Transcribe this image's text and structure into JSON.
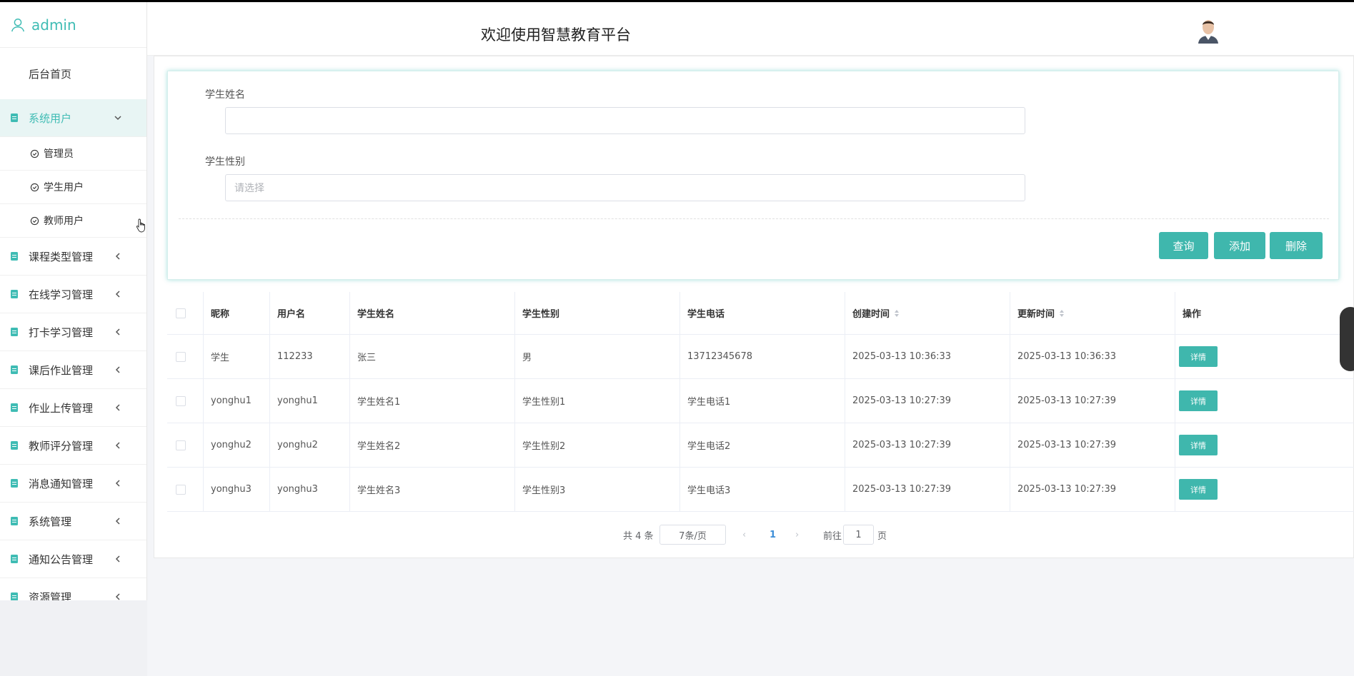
{
  "sidebar": {
    "user_name": "admin",
    "home": "后台首页",
    "groups": [
      {
        "label": "系统用户",
        "active": true,
        "expanded": true,
        "children": [
          "管理员",
          "学生用户",
          "教师用户"
        ]
      },
      {
        "label": "课程类型管理"
      },
      {
        "label": "在线学习管理"
      },
      {
        "label": "打卡学习管理"
      },
      {
        "label": "课后作业管理"
      },
      {
        "label": "作业上传管理"
      },
      {
        "label": "教师评分管理"
      },
      {
        "label": "消息通知管理"
      },
      {
        "label": "系统管理"
      },
      {
        "label": "通知公告管理"
      },
      {
        "label": "资源管理"
      }
    ]
  },
  "header": {
    "title": "欢迎使用智慧教育平台"
  },
  "search": {
    "name_label": "学生姓名",
    "name_value": "",
    "gender_label": "学生性别",
    "gender_placeholder": "请选择",
    "query_label": "查询",
    "add_label": "添加",
    "delete_label": "删除"
  },
  "table": {
    "columns": [
      "昵称",
      "用户名",
      "学生姓名",
      "学生性别",
      "学生电话",
      "创建时间",
      "更新时间",
      "操作"
    ],
    "rows": [
      {
        "nickname": "学生",
        "username": "112233",
        "name": "张三",
        "gender": "男",
        "phone": "13712345678",
        "created": "2025-03-13 10:36:33",
        "updated": "2025-03-13 10:36:33",
        "action": "详情"
      },
      {
        "nickname": "yonghu1",
        "username": "yonghu1",
        "name": "学生姓名1",
        "gender": "学生性别1",
        "phone": "学生电话1",
        "created": "2025-03-13 10:27:39",
        "updated": "2025-03-13 10:27:39",
        "action": "详情"
      },
      {
        "nickname": "yonghu2",
        "username": "yonghu2",
        "name": "学生姓名2",
        "gender": "学生性别2",
        "phone": "学生电话2",
        "created": "2025-03-13 10:27:39",
        "updated": "2025-03-13 10:27:39",
        "action": "详情"
      },
      {
        "nickname": "yonghu3",
        "username": "yonghu3",
        "name": "学生姓名3",
        "gender": "学生性别3",
        "phone": "学生电话3",
        "created": "2025-03-13 10:27:39",
        "updated": "2025-03-13 10:27:39",
        "action": "详情"
      }
    ]
  },
  "pagination": {
    "total": "共 4 条",
    "page_size": "7条/页",
    "current_page": "1",
    "goto_prefix": "前往",
    "goto_value": "1",
    "goto_suffix": "页"
  },
  "colors": {
    "accent": "#3fb7ad",
    "sidebar_active_bg": "#e8f5f4"
  },
  "icons": {
    "user": "user-icon",
    "doc": "document-icon",
    "chevron_down": "chevron-down-icon",
    "chevron_left": "chevron-left-icon",
    "check_circle": "check-circle-icon",
    "sort": "sort-icon",
    "avatar": "avatar-image"
  }
}
